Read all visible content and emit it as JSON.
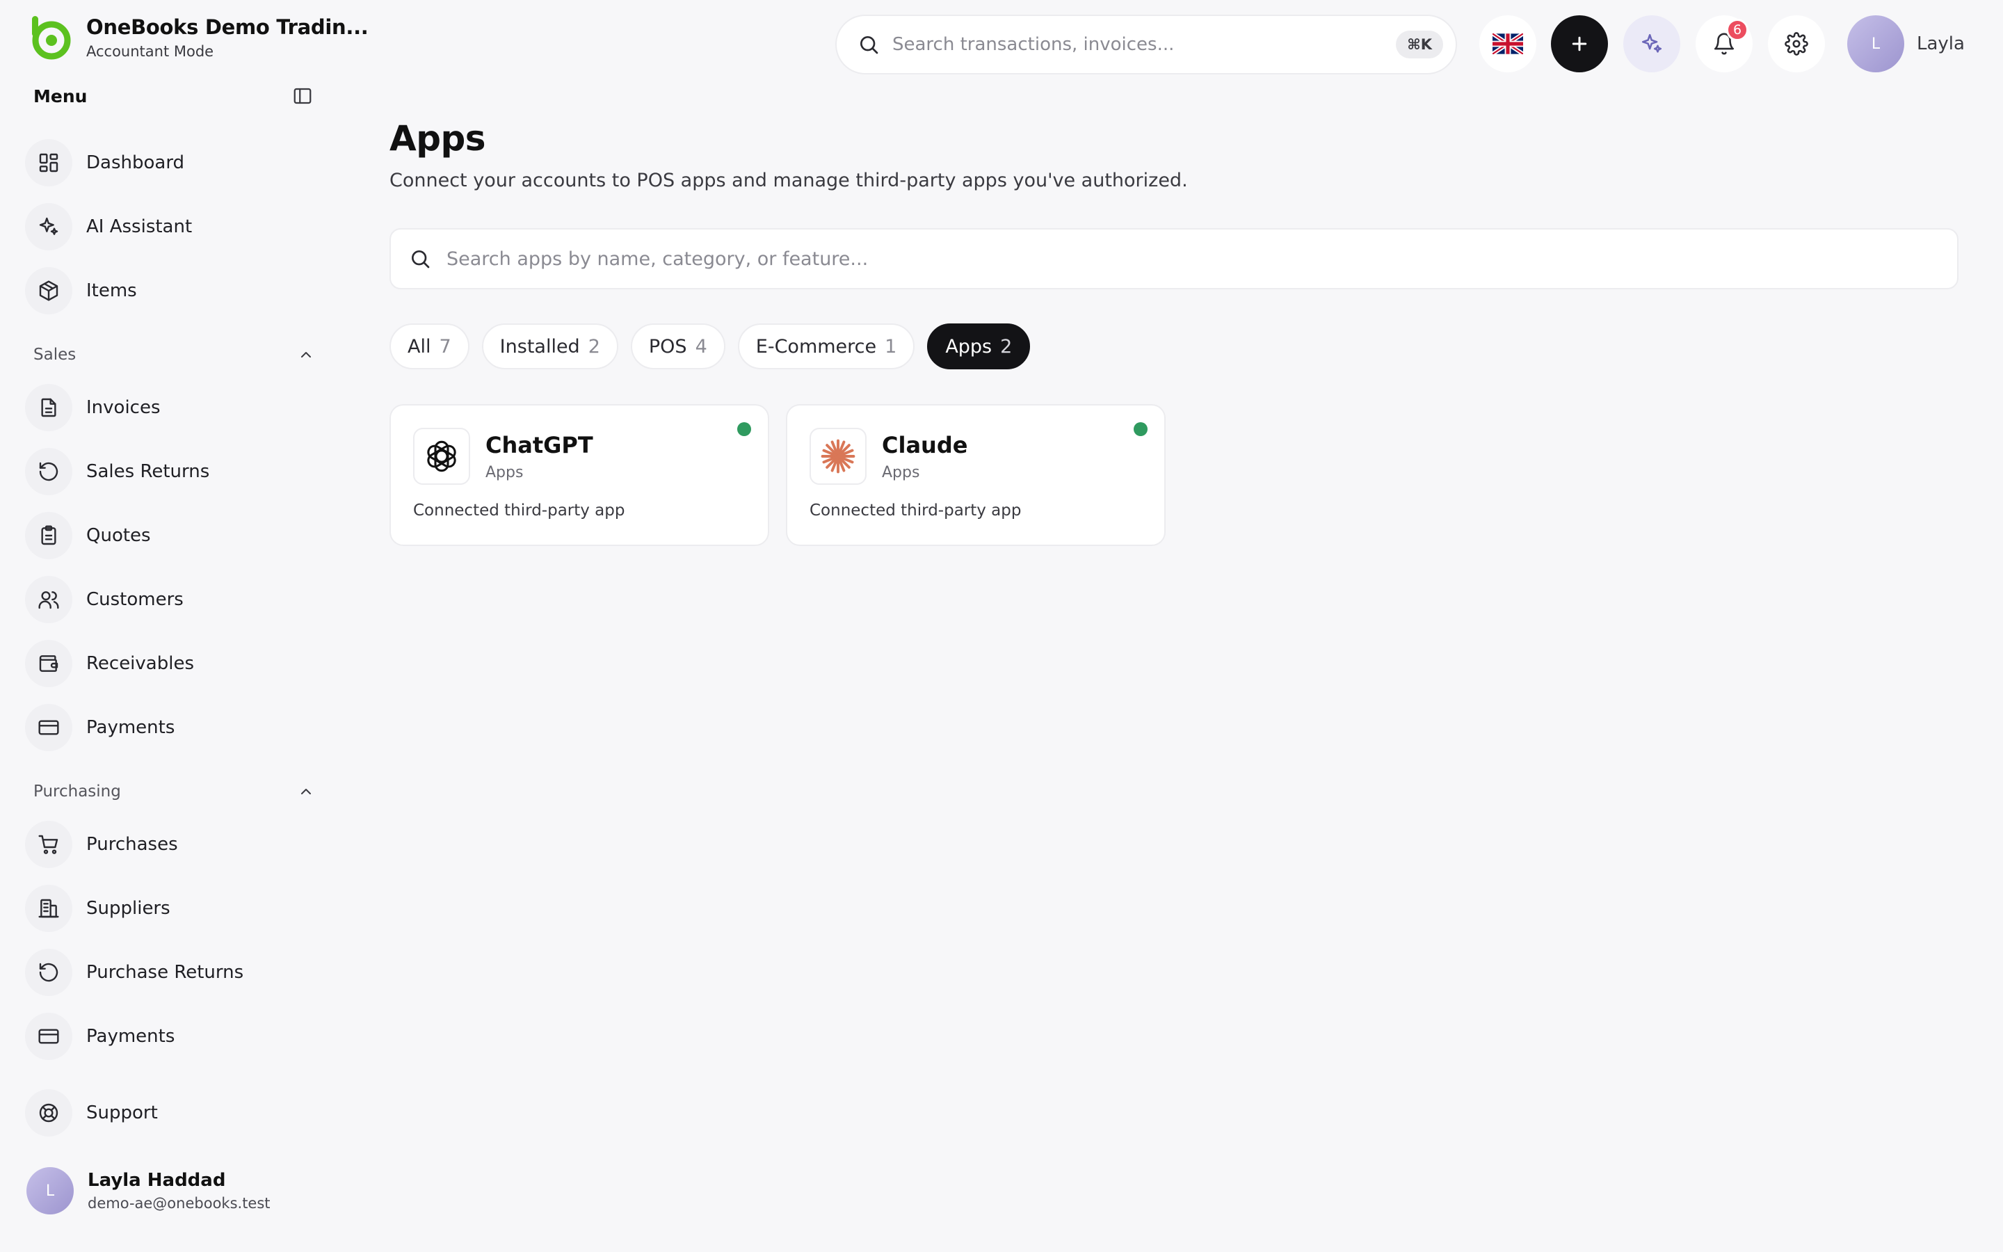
{
  "brand": {
    "name": "OneBooks Demo Tradin...",
    "mode": "Accountant Mode"
  },
  "sidebar": {
    "menu_title": "Menu",
    "top_items": [
      {
        "label": "Dashboard",
        "icon": "dashboard-icon"
      },
      {
        "label": "AI Assistant",
        "icon": "sparkles-icon"
      },
      {
        "label": "Items",
        "icon": "box-icon"
      }
    ],
    "sales": {
      "title": "Sales",
      "items": [
        {
          "label": "Invoices",
          "icon": "document-icon"
        },
        {
          "label": "Sales Returns",
          "icon": "rotate-ccw-icon"
        },
        {
          "label": "Quotes",
          "icon": "clipboard-icon"
        },
        {
          "label": "Customers",
          "icon": "users-icon"
        },
        {
          "label": "Receivables",
          "icon": "wallet-icon"
        },
        {
          "label": "Payments",
          "icon": "credit-card-icon"
        }
      ]
    },
    "purchasing": {
      "title": "Purchasing",
      "items": [
        {
          "label": "Purchases",
          "icon": "cart-icon"
        },
        {
          "label": "Suppliers",
          "icon": "building-icon"
        },
        {
          "label": "Purchase Returns",
          "icon": "rotate-ccw-icon"
        },
        {
          "label": "Payments",
          "icon": "credit-card-icon"
        }
      ]
    },
    "support": {
      "label": "Support",
      "icon": "lifebuoy-icon"
    },
    "user": {
      "initial": "L",
      "name": "Layla Haddad",
      "email": "demo-ae@onebooks.test"
    }
  },
  "topbar": {
    "search_placeholder": "Search transactions, invoices...",
    "shortcut": "⌘K",
    "notifications_count": "6",
    "user_initial": "L",
    "user_name": "Layla"
  },
  "main": {
    "title": "Apps",
    "subtitle": "Connect your accounts to POS apps and manage third-party apps you've authorized.",
    "search_placeholder": "Search apps by name, category, or feature...",
    "filters": [
      {
        "label": "All",
        "count": "7",
        "active": false
      },
      {
        "label": "Installed",
        "count": "2",
        "active": false
      },
      {
        "label": "POS",
        "count": "4",
        "active": false
      },
      {
        "label": "E-Commerce",
        "count": "1",
        "active": false
      },
      {
        "label": "Apps",
        "count": "2",
        "active": true
      }
    ],
    "cards": [
      {
        "name": "ChatGPT",
        "category": "Apps",
        "description": "Connected third-party app",
        "icon": "chatgpt-logo-icon",
        "status": "connected"
      },
      {
        "name": "Claude",
        "category": "Apps",
        "description": "Connected third-party app",
        "icon": "claude-logo-icon",
        "status": "connected"
      }
    ]
  },
  "colors": {
    "brand_green": "#5cc11f",
    "dark": "#131316",
    "status_green": "#2f9a5f",
    "badge_red": "#ec4d5f",
    "claude_orange": "#d97757"
  }
}
